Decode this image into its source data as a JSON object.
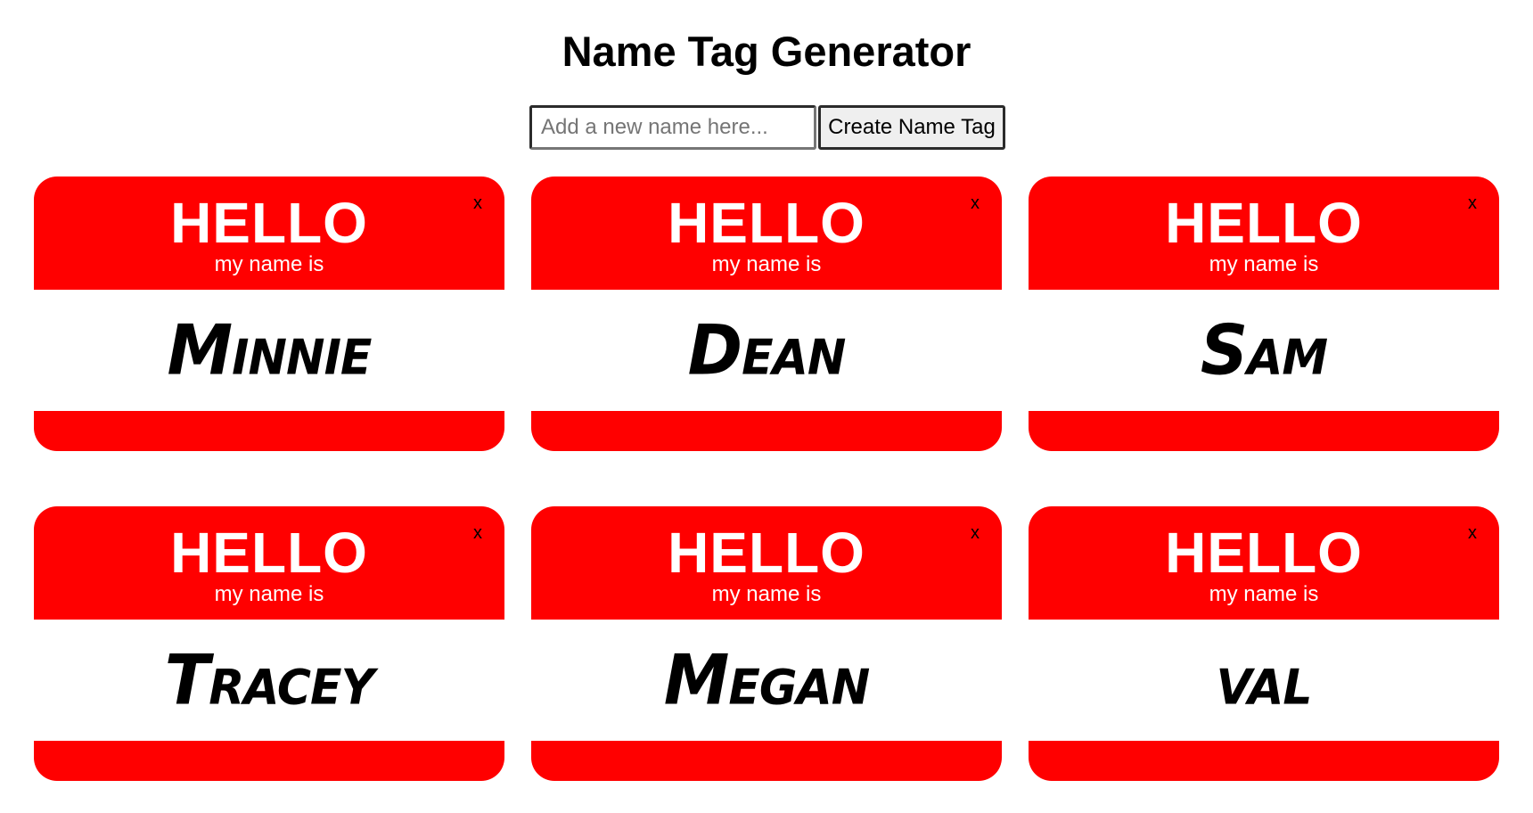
{
  "header": {
    "title": "Name Tag Generator"
  },
  "form": {
    "input_placeholder": "Add a new name here...",
    "input_value": "",
    "button_label": "Create Name Tag"
  },
  "tag_template": {
    "greeting": "HELLO",
    "subtitle": "my name is",
    "close_label": "x"
  },
  "tags": [
    {
      "name": "Minnie"
    },
    {
      "name": "Dean"
    },
    {
      "name": "Sam"
    },
    {
      "name": "Tracey"
    },
    {
      "name": "Megan"
    },
    {
      "name": "val"
    }
  ],
  "colors": {
    "tag_red": "#ff0000",
    "tag_text": "#ffffff",
    "name_text": "#000000"
  }
}
